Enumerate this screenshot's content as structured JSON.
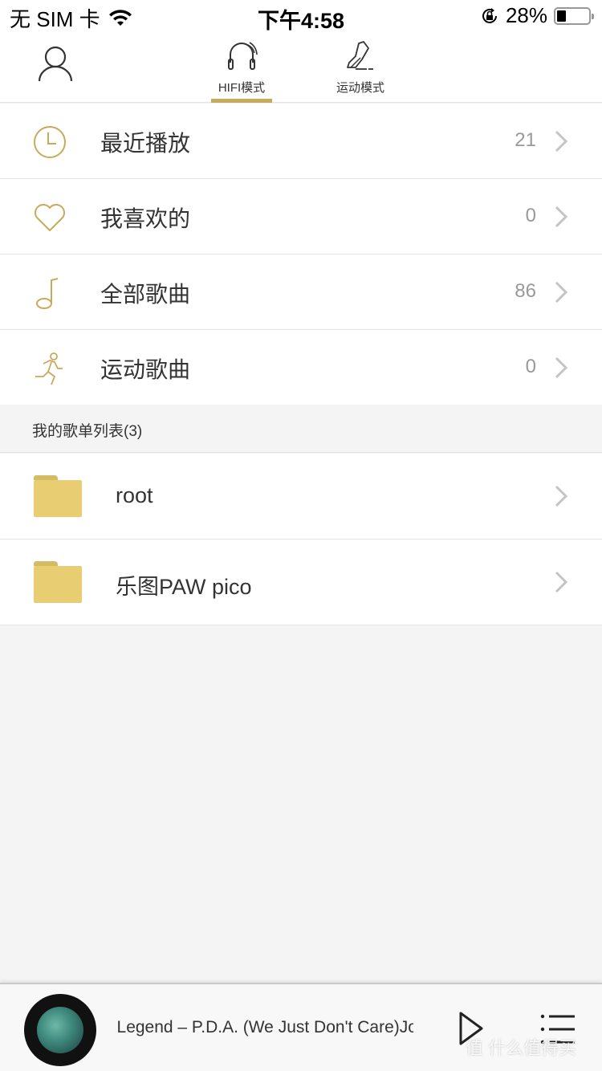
{
  "status_bar": {
    "carrier": "无 SIM 卡",
    "time": "下午4:58",
    "battery_percent_label": "28%",
    "battery_level": 0.28
  },
  "top_nav": {
    "tabs": [
      {
        "label": "HIFI模式",
        "icon": "headphones-icon",
        "active": true
      },
      {
        "label": "运动模式",
        "icon": "sneaker-icon",
        "active": false
      }
    ],
    "accent_color": "#c8aa5c"
  },
  "menu": {
    "items": [
      {
        "label": "最近播放",
        "count": "21",
        "icon": "clock-icon"
      },
      {
        "label": "我喜欢的",
        "count": "0",
        "icon": "heart-icon"
      },
      {
        "label": "全部歌曲",
        "count": "86",
        "icon": "music-note-icon"
      },
      {
        "label": "运动歌曲",
        "count": "0",
        "icon": "running-person-icon"
      }
    ]
  },
  "playlists": {
    "header": "我的歌单列表(3)",
    "items": [
      {
        "label": "root"
      },
      {
        "label": "乐图PAW pico"
      }
    ]
  },
  "player": {
    "track_title": "n Legend – P.D.A. (We Just Don't Care)John Legend"
  },
  "watermark": "值 什么值得买"
}
